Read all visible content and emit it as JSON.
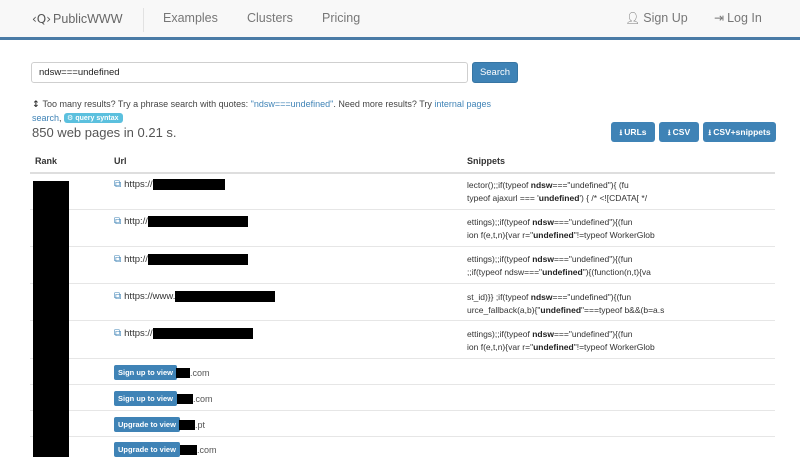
{
  "nav": {
    "brand_glyph": "‹Q›",
    "brand": "PublicWWW",
    "links": [
      "Examples",
      "Clusters",
      "Pricing"
    ],
    "signup": "Sign Up",
    "login": "Log In"
  },
  "search": {
    "value": "ndsw===undefined",
    "button": "Search"
  },
  "hint": {
    "arrow": "↕",
    "part1": "Too many results? Try a phrase search with quotes: ",
    "quoted": "\"ndsw===undefined\"",
    "part2": ". Need more results? Try ",
    "link1": "internal pages search",
    "comma": ",",
    "badge": "query syntax"
  },
  "result_count": "850 web pages in 0.21 s.",
  "downloads": {
    "urls": "URLs",
    "csv": "CSV",
    "csv_snippets": "CSV+snippets"
  },
  "table": {
    "headers": [
      "Rank",
      "Url",
      "Snippets"
    ],
    "rows": [
      {
        "url_prefix": "https://",
        "s1": [
          "lector();;if(typeof ",
          "ndsw",
          "===\"undefined\"){ (fu"
        ],
        "s2": [
          "typeof ajaxurl === '",
          "undefined",
          "') { /* <![CDATA[ */"
        ]
      },
      {
        "url_prefix": "http://",
        "s1": [
          "ettings);;if(typeof ",
          "ndsw",
          "===\"undefined\"){(fun"
        ],
        "s2": [
          "ion f(e,t,n){var r=\"",
          "undefined",
          "\"!=typeof WorkerGlob"
        ]
      },
      {
        "url_prefix": "http://",
        "s1": [
          "ettings);;if(typeof ",
          "ndsw",
          "===\"undefined\"){(fun"
        ],
        "s2": [
          ";;if(typeof ndsw===\"",
          "undefined",
          "\"){(function(n,t){va"
        ]
      },
      {
        "url_prefix": "https://www.",
        "s1": [
          "st_id)}} ;if(typeof ",
          "ndsw",
          "===\"undefined\"){(fun"
        ],
        "s2": [
          "urce_fallback(a,b){\"",
          "undefined",
          "\"===typeof b&&(b=a.s"
        ]
      },
      {
        "url_prefix": "https://",
        "s1": [
          "ettings);;if(typeof ",
          "ndsw",
          "===\"undefined\"){(fun"
        ],
        "s2": [
          "ion f(e,t,n){var r=\"",
          "undefined",
          "\"!=typeof WorkerGlob"
        ]
      }
    ],
    "locked": [
      {
        "button": "Sign up to view",
        "suffix": ".com"
      },
      {
        "button": "Sign up to view",
        "suffix": ".com"
      },
      {
        "button": "Upgrade to view",
        "suffix": ".pt"
      },
      {
        "button": "Upgrade to view",
        "suffix": ".com"
      }
    ]
  },
  "colors": {
    "accent": "#3f83b6",
    "nav_border": "#4a7ba6",
    "badge": "#5bc0de",
    "redaction": "#000000"
  },
  "icons": [
    "brand-logo-icon",
    "user-icon",
    "login-icon",
    "sort-arrow-icon",
    "search-badge-icon",
    "download-icon",
    "external-link-icon"
  ]
}
